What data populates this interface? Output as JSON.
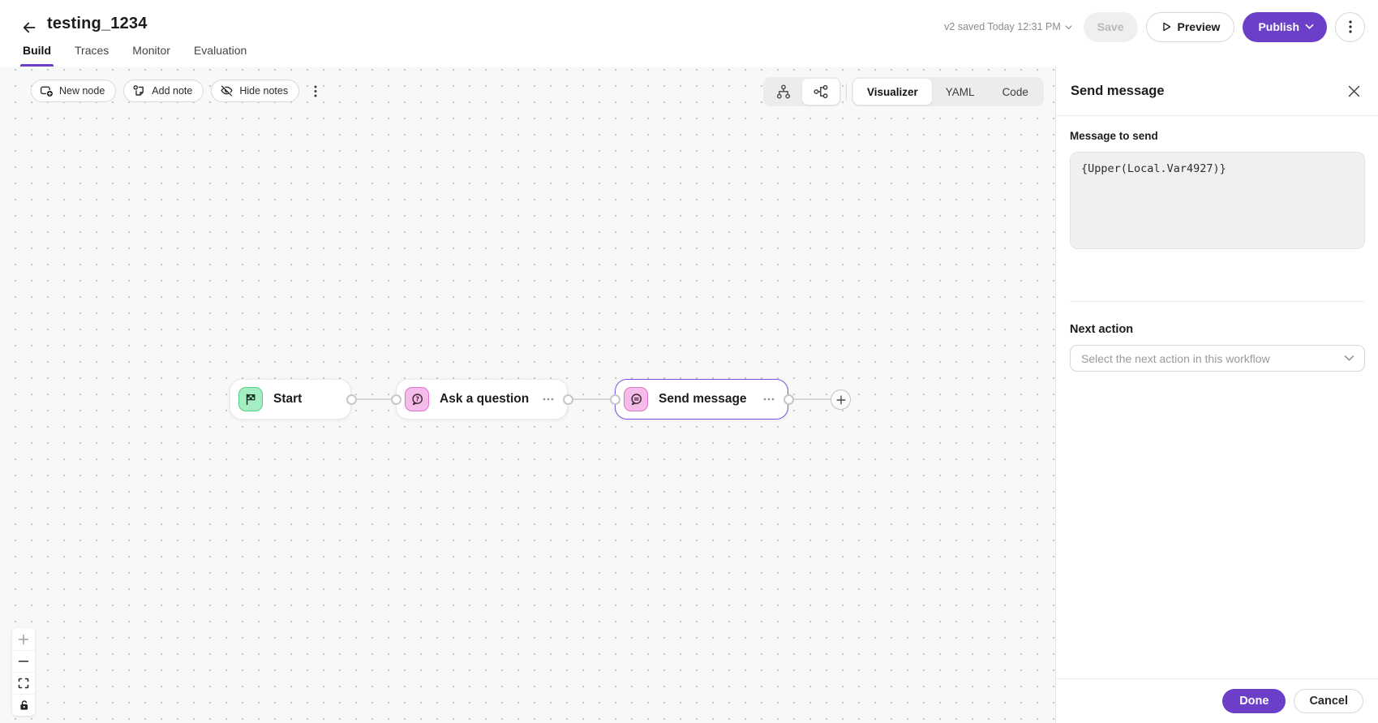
{
  "header": {
    "title": "testing_1234",
    "tabs": [
      {
        "label": "Build",
        "active": true
      },
      {
        "label": "Traces",
        "active": false
      },
      {
        "label": "Monitor",
        "active": false
      },
      {
        "label": "Evaluation",
        "active": false
      }
    ],
    "version_status": "v2 saved Today 12:31 PM",
    "save_label": "Save",
    "preview_label": "Preview",
    "publish_label": "Publish"
  },
  "canvas": {
    "toolbar": {
      "new_node_label": "New node",
      "add_note_label": "Add note",
      "hide_notes_label": "Hide notes"
    },
    "view_tabs": [
      {
        "label": "Visualizer",
        "active": true
      },
      {
        "label": "YAML",
        "active": false
      },
      {
        "label": "Code",
        "active": false
      }
    ],
    "nodes": [
      {
        "label": "Start",
        "icon": "flag-icon",
        "color": "green",
        "selected": false
      },
      {
        "label": "Ask a question",
        "icon": "question-bubble-icon",
        "color": "pink",
        "selected": false
      },
      {
        "label": "Send message",
        "icon": "message-bubble-icon",
        "color": "pink",
        "selected": true
      }
    ]
  },
  "panel": {
    "title": "Send message",
    "message_label": "Message to send",
    "message_value": "{Upper(Local.Var4927)}",
    "next_action_label": "Next action",
    "next_action_placeholder": "Select the next action in this workflow",
    "done_label": "Done",
    "cancel_label": "Cancel"
  },
  "icons": {
    "back": "arrow-left-icon",
    "layout_vertical": "tree-vertical-icon",
    "layout_horizontal": "tree-horizontal-icon",
    "zoom_controls": [
      "zoom-in-icon",
      "zoom-out-icon",
      "fit-screen-icon",
      "lock-icon"
    ]
  },
  "colors": {
    "accent": "#6c3fc8",
    "selected_node_border": "#7c52e0",
    "start_icon_bg": "#a6edc3",
    "start_icon_border": "#53cd88",
    "message_icon_bg": "#f6bce9",
    "message_icon_border": "#e070d0",
    "canvas_bg": "#f8f8f8"
  }
}
